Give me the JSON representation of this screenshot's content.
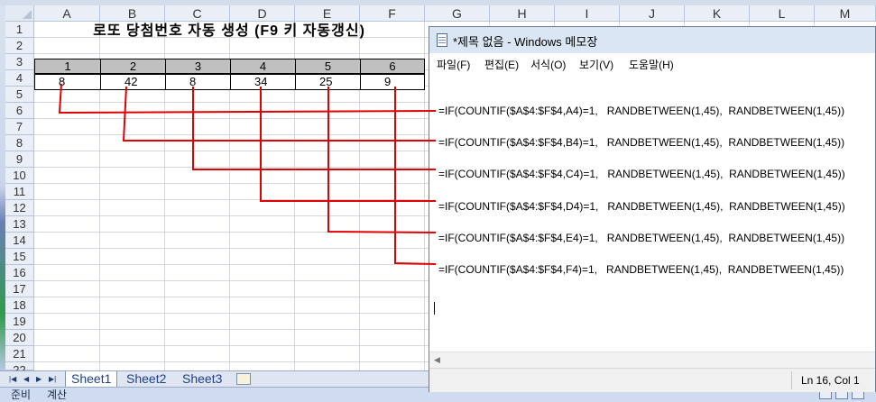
{
  "excel": {
    "column_headers": [
      "A",
      "B",
      "C",
      "D",
      "E",
      "F",
      "G",
      "H",
      "I",
      "J",
      "K",
      "L",
      "M"
    ],
    "row_headers": [
      "1",
      "2",
      "3",
      "4",
      "5",
      "6",
      "7",
      "8",
      "9",
      "10",
      "11",
      "12",
      "13",
      "14",
      "15",
      "16",
      "17",
      "18",
      "19",
      "20",
      "21",
      "22"
    ],
    "title": "로또  당첨번호 자동 생성 (F9 키 자동갱신)",
    "number_headers": [
      "1",
      "2",
      "3",
      "4",
      "5",
      "6"
    ],
    "values": [
      "8",
      "42",
      "8",
      "34",
      "25",
      "9"
    ],
    "sheet_tabs": [
      "Sheet1",
      "Sheet2",
      "Sheet3"
    ],
    "status": {
      "ready": "준비",
      "calc": "계산"
    }
  },
  "notepad": {
    "title": "*제목 없음 - Windows 메모장",
    "menu": [
      "파일(F)",
      "편집(E)",
      "서식(O)",
      "보기(V)",
      "도움말(H)"
    ],
    "formulas": [
      "=IF(COUNTIF($A$4:$F$4,A4)=1,   RANDBETWEEN(1,45),  RANDBETWEEN(1,45))",
      "=IF(COUNTIF($A$4:$F$4,B4)=1,   RANDBETWEEN(1,45),  RANDBETWEEN(1,45))",
      "=IF(COUNTIF($A$4:$F$4,C4)=1,   RANDBETWEEN(1,45),  RANDBETWEEN(1,45))",
      "=IF(COUNTIF($A$4:$F$4,D4)=1,   RANDBETWEEN(1,45),  RANDBETWEEN(1,45))",
      "=IF(COUNTIF($A$4:$F$4,E4)=1,   RANDBETWEEN(1,45),  RANDBETWEEN(1,45))",
      "=IF(COUNTIF($A$4:$F$4,F4)=1,   RANDBETWEEN(1,45),  RANDBETWEEN(1,45))"
    ],
    "status": "Ln 16, Col 1"
  },
  "colors": {
    "annotation_line": "#e00000",
    "header_fill": "#c0c0c0"
  },
  "icons": [
    "notepad-icon",
    "select-all-icon",
    "sheet-nav-first-icon",
    "sheet-nav-prev-icon",
    "sheet-nav-next-icon",
    "sheet-nav-last-icon",
    "insert-sheet-icon"
  ]
}
